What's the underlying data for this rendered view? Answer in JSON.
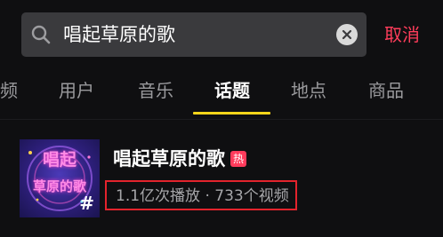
{
  "search": {
    "query": "唱起草原的歌",
    "cancel_label": "取消"
  },
  "tabs": [
    {
      "label": "频",
      "active": false
    },
    {
      "label": "用户",
      "active": false
    },
    {
      "label": "音乐",
      "active": false
    },
    {
      "label": "话题",
      "active": true
    },
    {
      "label": "地点",
      "active": false
    },
    {
      "label": "商品",
      "active": false
    }
  ],
  "result": {
    "title": "唱起草原的歌",
    "hot_badge": "热",
    "stats": "1.1亿次播放 · 733个视频",
    "thumbnail_text": "唱起草原的歌",
    "thumbnail_hash": "#"
  },
  "colors": {
    "background": "#0f0f11",
    "accent_cancel": "#ff3d5b",
    "tab_underline": "#f6d51b",
    "highlight_box": "#e3232c"
  }
}
